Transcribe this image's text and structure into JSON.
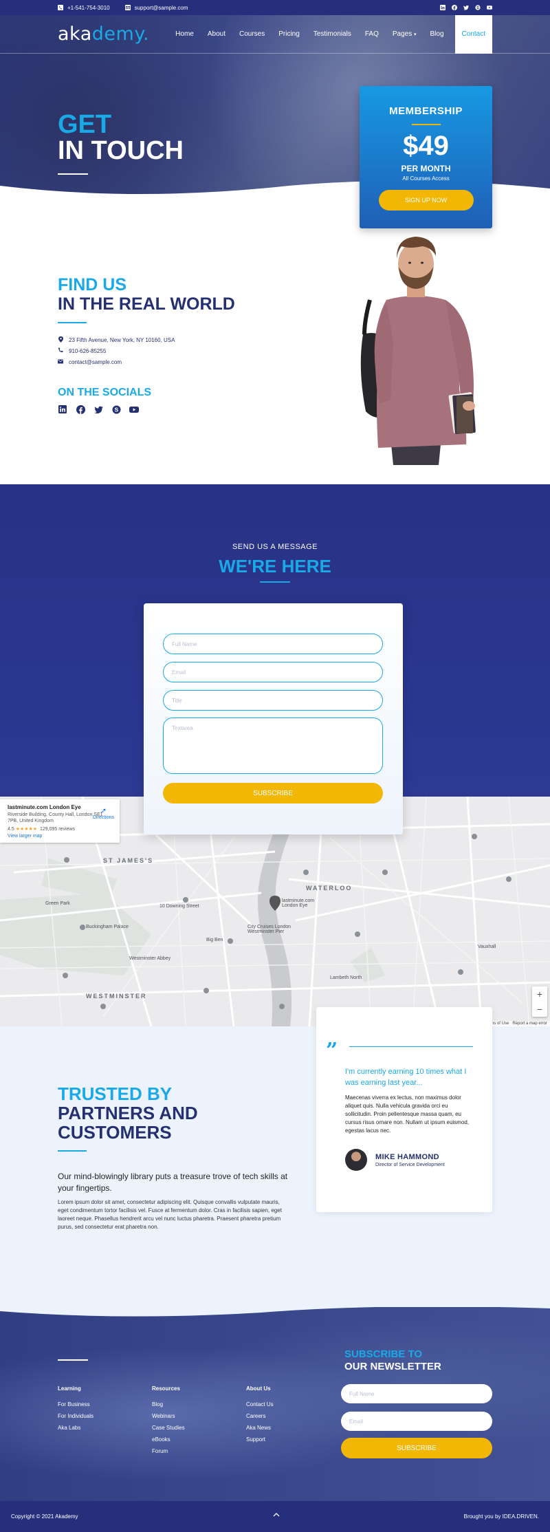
{
  "topbar": {
    "phone": "+1-541-754-3010",
    "email": "support@sample.com",
    "socials": [
      "linkedin-icon",
      "facebook-icon",
      "twitter-icon",
      "skype-icon",
      "youtube-icon"
    ]
  },
  "nav": {
    "logo_main": "aka",
    "logo_accent": "demy",
    "items": [
      "Home",
      "About",
      "Courses",
      "Pricing",
      "Testimonials",
      "FAQ",
      "Pages",
      "Blog"
    ],
    "active": "Contact"
  },
  "hero": {
    "line1": "GET",
    "line2": "IN TOUCH"
  },
  "membership": {
    "title": "MEMBERSHIP",
    "price": "$49",
    "period": "PER MONTH",
    "access": "All Courses Access",
    "cta": "SIGN UP NOW"
  },
  "findus": {
    "line1": "FIND US",
    "line2": "IN THE REAL WORLD",
    "address": "23 Fifth Avenue, New York, NY 10160, USA",
    "phone": "910-626-85255",
    "email": "contact@sample.com",
    "socials_title": "ON THE SOCIALS"
  },
  "message": {
    "subtitle": "SEND US A MESSAGE",
    "title": "WE'RE HERE",
    "placeholders": {
      "name": "Full Name",
      "email": "Email",
      "title": "Title",
      "textarea": "Textarea"
    },
    "submit": "SUBSCRIBE"
  },
  "map": {
    "place": "lastminute.com London Eye",
    "address": "Riverside Building, County Hall, London SE1 7PB, United Kingdom",
    "rating": "4.5",
    "stars": "★★★★★",
    "reviews": "129,095 reviews",
    "larger": "View larger map",
    "directions": "Directions",
    "terms": "Terms of Use",
    "report": "Report a map error",
    "labels": {
      "waterloo": "WATERLOO",
      "westminster": "WESTMINSTER",
      "st_james": "ST JAMES'S",
      "big_ben": "Big Ben",
      "london_eye": "lastminute.com London Eye",
      "buckingham": "Buckingham Palace",
      "green_park": "Green Park",
      "downing": "10 Downing Street",
      "city_cruises": "City Cruises London Westminster Pier",
      "westminster_abbey": "Westminster Abbey",
      "lambeth": "Lambeth North",
      "vauxhall": "Vauxhall"
    }
  },
  "trusted": {
    "line1": "TRUSTED BY",
    "line2": "PARTNERS AND",
    "line3": "CUSTOMERS",
    "lead": "Our mind-blowingly library puts a treasure trove of tech skills at your fingertips.",
    "body": "Lorem ipsum dolor sit amet, consectetur adipiscing elit. Quisque convallis vulputate mauris, eget condimentum tortor facilisis vel. Fusce at fermentum dolor. Cras in facilisis sapien, eget laoreet neque. Phasellus hendrerit arcu vel nunc luctus pharetra. Praesent pharetra pretium purus, sed consectetur erat pharetra non."
  },
  "testimonial": {
    "quote_mark": "”",
    "headline": "I'm currently earning 10 times what I was earning last year...",
    "body": "Maecenas viverra ex lectus, non maximus dolor aliquet quis. Nulla vehicula gravida orci eu sollicitudin. Proin pellentesque massa quam, eu cursus risus ornare non. Nullam ut ipsum euismod, egestas lacus nec.",
    "name": "MIKE HAMMOND",
    "role": "Director of Service Development"
  },
  "footer": {
    "columns": [
      {
        "title": "Learning",
        "items": [
          "For Business",
          "For Individuals",
          "Aka Labs"
        ]
      },
      {
        "title": "Resources",
        "items": [
          "Blog",
          "Webinars",
          "Case Studies",
          "eBooks",
          "Forum"
        ]
      },
      {
        "title": "About Us",
        "items": [
          "Contact Us",
          "Careers",
          "Aka News",
          "Support"
        ]
      }
    ],
    "nl_line1": "SUBSCRIBE TO",
    "nl_line2": "OUR NEWSLETTER",
    "nl_name": "Full Name",
    "nl_email": "Email",
    "nl_submit": "SUBSCRIBE",
    "copyright": "Copyright © 2021 Akademy",
    "credit": "Brought you by IDEA.DRIVEN."
  },
  "colors": {
    "navy": "#262f7c",
    "accent": "#19a9e7",
    "yellow": "#f2b705",
    "light_bg": "#edf3fc"
  }
}
